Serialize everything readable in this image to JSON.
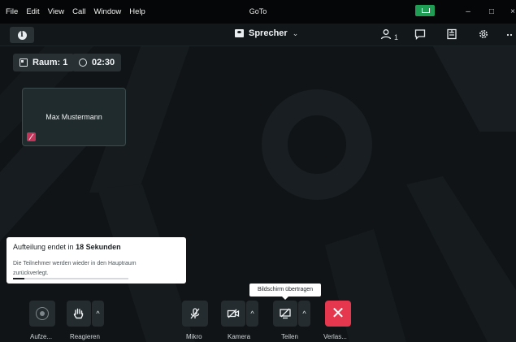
{
  "menubar": {
    "items": [
      "File",
      "Edit",
      "View",
      "Call",
      "Window",
      "Help"
    ],
    "app_title": "GoTo"
  },
  "window_controls": {
    "minimize": "–",
    "maximize": "□",
    "close": "×"
  },
  "topbar": {
    "info_label": "i",
    "layout_label": "Sprecher",
    "layout_chevron": "⌄",
    "participant_count": "1"
  },
  "room": {
    "room_label": "Raum: 1",
    "timer": "02:30"
  },
  "tile": {
    "participant_name": "Max Mustermann"
  },
  "notification": {
    "title_prefix": "Aufteilung endet in ",
    "title_bold": "18 Sekunden",
    "description": "Die Teilnehmer werden wieder in den Hauptraum zurückverlegt.",
    "progress": 0.1
  },
  "tooltip": "Bildschirm übertragen",
  "controls": [
    {
      "label": "Aufze..."
    },
    {
      "label": "Reagieren"
    },
    {
      "label": "Mikro"
    },
    {
      "label": "Kamera"
    },
    {
      "label": "Teilen"
    },
    {
      "label": "Verlas..."
    }
  ],
  "icons": {
    "participants": "person-icon",
    "chat": "chat-icon",
    "notes": "notes-icon",
    "settings": "gear-icon",
    "more": "more-icon"
  },
  "colors": {
    "end_call": "#e5374e",
    "accent_green": "#1f9d55",
    "mic_off_badge": "#c2355b"
  }
}
